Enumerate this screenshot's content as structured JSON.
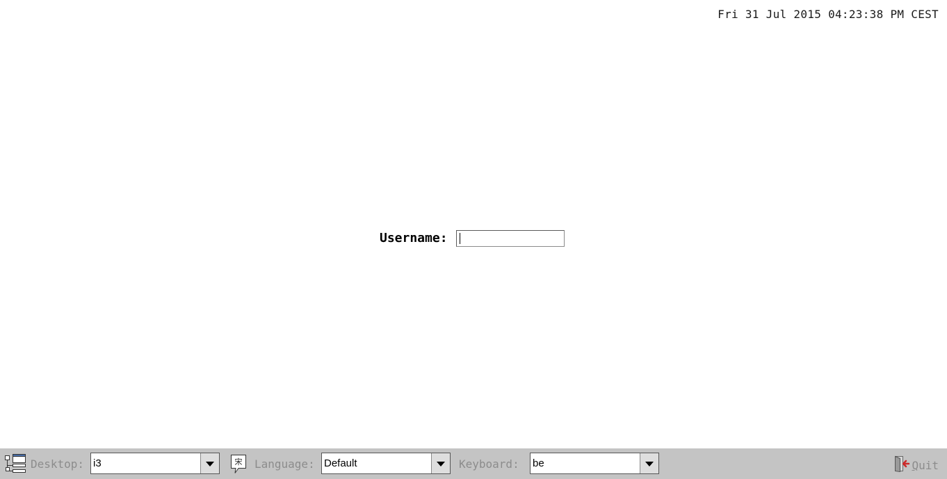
{
  "clock": "Fri 31 Jul 2015 04:23:38 PM CEST",
  "login": {
    "username_label": "Username:",
    "username_value": ""
  },
  "bottom_bar": {
    "desktop": {
      "icon": "desktop-session-icon",
      "label": "Desktop:",
      "value": "i3"
    },
    "language": {
      "icon": "language-icon",
      "label": "Language:",
      "value": "Default"
    },
    "keyboard": {
      "label": "Keyboard:",
      "value": "be"
    },
    "quit": {
      "icon": "quit-icon",
      "label_first": "Q",
      "label_rest": "uit"
    }
  },
  "colors": {
    "background": "#ffffff",
    "bar_background": "#c4c4c4",
    "disabled_text": "#8c8c8c",
    "quit_arrow": "#cc2a2a"
  }
}
